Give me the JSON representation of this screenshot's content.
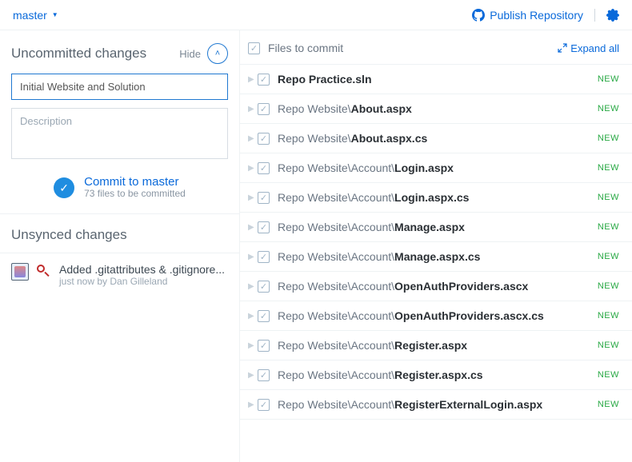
{
  "branch": "master",
  "publish_label": "Publish Repository",
  "left": {
    "changes_header": "Uncommitted changes",
    "hide": "Hide",
    "subject_value": "Initial Website and Solution",
    "desc_placeholder": "Description",
    "commit_label": "Commit to master",
    "commit_sub": "73 files to be committed",
    "unsynced_header": "Unsynced changes",
    "commit": {
      "message": "Added .gitattributes & .gitignore...",
      "time": "just now",
      "author": "Dan Gilleland"
    }
  },
  "right": {
    "header": "Files to commit",
    "expand_all": "Expand all",
    "files": [
      {
        "dir": "",
        "name": "Repo Practice.sln",
        "status": "NEW"
      },
      {
        "dir": "Repo Website\\",
        "name": "About.aspx",
        "status": "NEW"
      },
      {
        "dir": "Repo Website\\",
        "name": "About.aspx.cs",
        "status": "NEW"
      },
      {
        "dir": "Repo Website\\Account\\",
        "name": "Login.aspx",
        "status": "NEW"
      },
      {
        "dir": "Repo Website\\Account\\",
        "name": "Login.aspx.cs",
        "status": "NEW"
      },
      {
        "dir": "Repo Website\\Account\\",
        "name": "Manage.aspx",
        "status": "NEW"
      },
      {
        "dir": "Repo Website\\Account\\",
        "name": "Manage.aspx.cs",
        "status": "NEW"
      },
      {
        "dir": "Repo Website\\Account\\",
        "name": "OpenAuthProviders.ascx",
        "status": "NEW"
      },
      {
        "dir": "Repo Website\\Account\\",
        "name": "OpenAuthProviders.ascx.cs",
        "status": "NEW"
      },
      {
        "dir": "Repo Website\\Account\\",
        "name": "Register.aspx",
        "status": "NEW"
      },
      {
        "dir": "Repo Website\\Account\\",
        "name": "Register.aspx.cs",
        "status": "NEW"
      },
      {
        "dir": "Repo Website\\Account\\",
        "name": "RegisterExternalLogin.aspx",
        "status": "NEW"
      }
    ]
  }
}
